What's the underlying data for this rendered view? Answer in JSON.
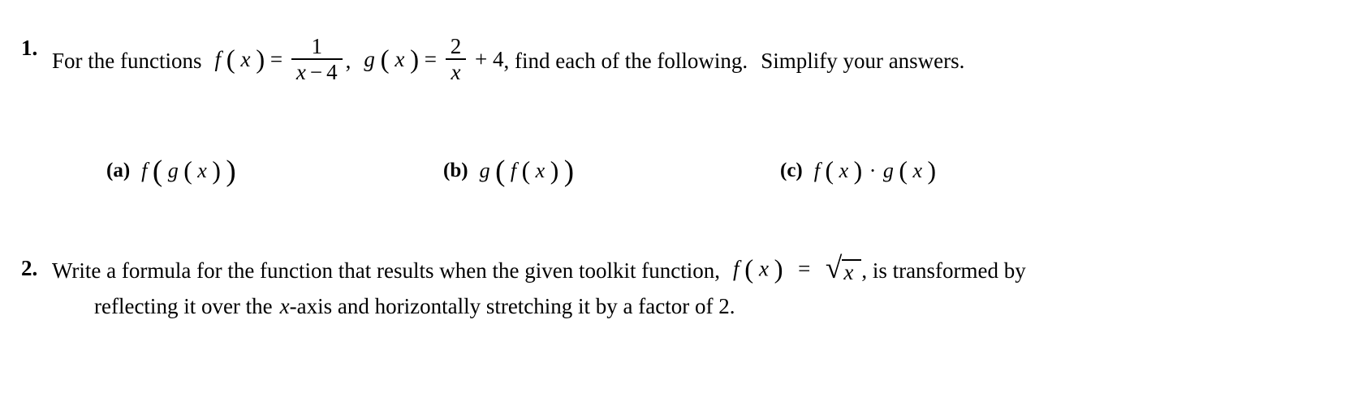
{
  "document": {
    "type": "math-worksheet",
    "background_color": "#ffffff",
    "text_color": "#000000"
  },
  "problems": [
    {
      "number": "1.",
      "statement_part_1": "For the functions",
      "f_name": "f",
      "f_arg": "x",
      "equals": "=",
      "f_numerator": "1",
      "f_denominator_var": "x",
      "f_denominator_minus": "−",
      "f_denominator_num": "4",
      "comma": ",",
      "g_name": "g",
      "g_arg": "x",
      "g_numerator": "2",
      "g_denominator": "x",
      "g_plus": "+",
      "g_constant": "4",
      "statement_part_2": ", find each of the following.",
      "statement_part_3": "Simplify your answers.",
      "subparts": [
        {
          "label": "(a)",
          "outer_fn": "f",
          "inner_fn": "g",
          "variable": "x"
        },
        {
          "label": "(b)",
          "outer_fn": "g",
          "inner_fn": "f",
          "variable": "x"
        },
        {
          "label": "(c)",
          "left_fn": "f",
          "operator": "·",
          "right_fn": "g",
          "variable": "x"
        }
      ]
    },
    {
      "number": "2.",
      "line_1_text_a": "Write a formula for the function that results when the given toolkit function,",
      "f_name": "f",
      "f_arg": "x",
      "equals": "=",
      "radical_sign": "√",
      "radicand": "x",
      "line_1_text_b": ", is transformed by",
      "line_2_text_a": "reflecting it over the",
      "line_2_var": "x",
      "line_2_text_b": "-axis and horizontally stretching it by a factor of 2."
    }
  ]
}
